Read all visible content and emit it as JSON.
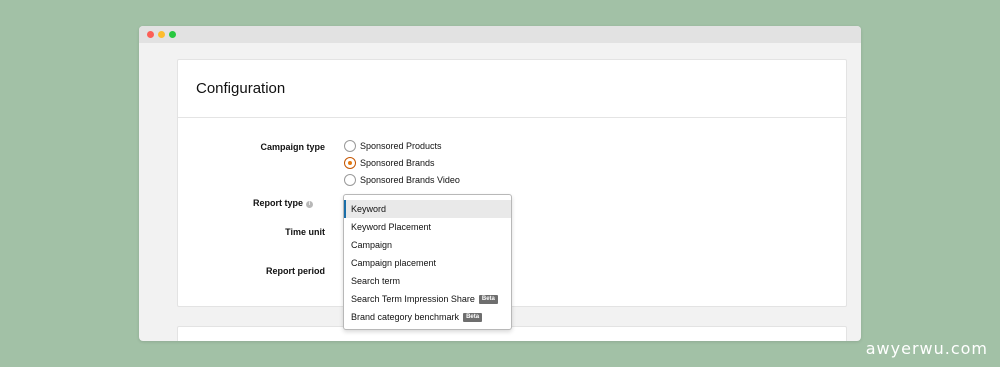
{
  "config": {
    "title": "Configuration",
    "campaign_type_label": "Campaign type",
    "campaign_type_options": [
      {
        "label": "Sponsored Products",
        "checked": false
      },
      {
        "label": "Sponsored Brands",
        "checked": true
      },
      {
        "label": "Sponsored Brands Video",
        "checked": false
      }
    ],
    "report_type_label": "Report type",
    "time_unit_label": "Time unit",
    "report_period_label": "Report period"
  },
  "report_type_dropdown": {
    "options": [
      {
        "label": "Keyword",
        "selected": true,
        "badge": ""
      },
      {
        "label": "Keyword Placement",
        "selected": false,
        "badge": ""
      },
      {
        "label": "Campaign",
        "selected": false,
        "badge": ""
      },
      {
        "label": "Campaign placement",
        "selected": false,
        "badge": ""
      },
      {
        "label": "Search term",
        "selected": false,
        "badge": ""
      },
      {
        "label": "Search Term Impression Share",
        "selected": false,
        "badge": "Beta"
      },
      {
        "label": "Brand category benchmark",
        "selected": false,
        "badge": "Beta"
      }
    ]
  },
  "watermark": "awyerwu.com",
  "colors": {
    "background": "#a2c1a6",
    "radio_accent": "#e47911",
    "selected_bar": "#1a6ea8"
  }
}
